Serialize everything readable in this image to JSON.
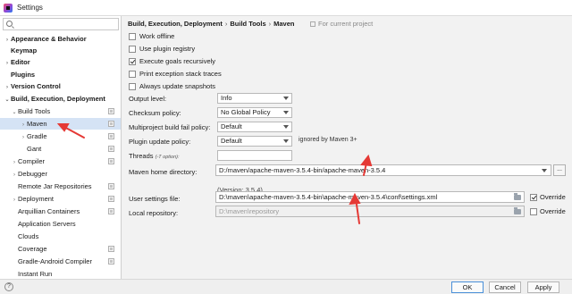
{
  "window": {
    "title": "Settings"
  },
  "sidebar": {
    "search_placeholder": "",
    "items": [
      {
        "label": "Appearance & Behavior",
        "arrow": "›",
        "bold": true
      },
      {
        "label": "Keymap",
        "arrow": "",
        "bold": true
      },
      {
        "label": "Editor",
        "arrow": "›",
        "bold": true
      },
      {
        "label": "Plugins",
        "arrow": "",
        "bold": true
      },
      {
        "label": "Version Control",
        "arrow": "›",
        "bold": true
      },
      {
        "label": "Build, Execution, Deployment",
        "arrow": "⌄",
        "bold": true
      },
      {
        "label": "Build Tools",
        "arrow": "⌄",
        "bold": false
      },
      {
        "label": "Maven",
        "arrow": "›",
        "bold": false,
        "selected": true
      },
      {
        "label": "Gradle",
        "arrow": "›",
        "bold": false
      },
      {
        "label": "Gant",
        "arrow": "",
        "bold": false
      },
      {
        "label": "Compiler",
        "arrow": "›",
        "bold": false
      },
      {
        "label": "Debugger",
        "arrow": "›",
        "bold": false
      },
      {
        "label": "Remote Jar Repositories",
        "arrow": "",
        "bold": false
      },
      {
        "label": "Deployment",
        "arrow": "›",
        "bold": false
      },
      {
        "label": "Arquillian Containers",
        "arrow": "",
        "bold": false
      },
      {
        "label": "Application Servers",
        "arrow": "",
        "bold": false
      },
      {
        "label": "Clouds",
        "arrow": "",
        "bold": false
      },
      {
        "label": "Coverage",
        "arrow": "",
        "bold": false
      },
      {
        "label": "Gradle-Android Compiler",
        "arrow": "",
        "bold": false
      },
      {
        "label": "Instant Run",
        "arrow": "",
        "bold": false
      }
    ]
  },
  "breadcrumb": {
    "part1": "Build, Execution, Deployment",
    "sep1": "›",
    "part2": "Build Tools",
    "sep2": "›",
    "part3": "Maven",
    "for_project": "For current project"
  },
  "options": {
    "work_offline": {
      "label": "Work offline",
      "checked": false
    },
    "use_plugin_registry": {
      "label": "Use plugin registry",
      "checked": false
    },
    "execute_goals_recursively": {
      "label": "Execute goals recursively",
      "checked": true
    },
    "print_exception": {
      "label": "Print exception stack traces",
      "checked": false
    },
    "always_update_snapshots": {
      "label": "Always update snapshots",
      "checked": false
    }
  },
  "fields": {
    "output_level_label": "Output level:",
    "output_level_value": "Info",
    "checksum_label": "Checksum policy:",
    "checksum_value": "No Global Policy",
    "multiproject_label": "Multiproject build fail policy:",
    "multiproject_value": "Default",
    "plugin_update_label": "Plugin update policy:",
    "plugin_update_value": "Default",
    "plugin_update_note": "ignored by Maven 3+",
    "threads_label": "Threads",
    "threads_hint": "(-T option):",
    "threads_value": "",
    "maven_home_label": "Maven home directory:",
    "maven_home_value": "D:/maven/apache-maven-3.5.4-bin/apache-maven-3.5.4",
    "browse_label": "...",
    "version_text": "(Version: 3.5.4)",
    "user_settings_label": "User settings file:",
    "user_settings_value": "D:\\maven\\apache-maven-3.5.4-bin\\apache-maven-3.5.4\\conf\\settings.xml",
    "user_settings_override": {
      "label": "Override",
      "checked": true
    },
    "local_repo_label": "Local repository:",
    "local_repo_value": "D:\\maven\\repository",
    "local_repo_override": {
      "label": "Override",
      "checked": false
    }
  },
  "buttons": {
    "help": "?",
    "ok": "OK",
    "cancel": "Cancel",
    "apply": "Apply"
  },
  "colors": {
    "annotation": "#e53935",
    "selection": "#d5e3f5"
  },
  "icons": {
    "app": "intellij-idea-icon",
    "search": "search-icon",
    "folder": "folder-icon"
  }
}
